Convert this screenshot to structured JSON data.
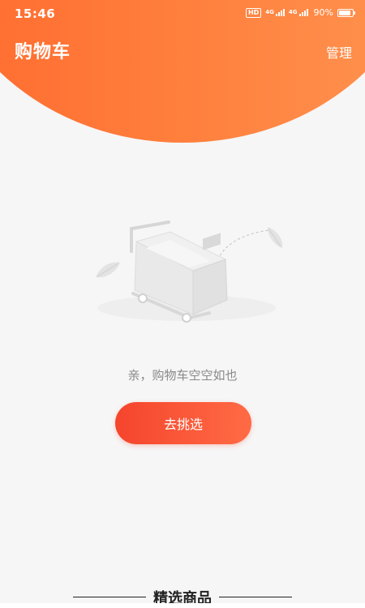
{
  "status_bar": {
    "time": "15:46",
    "hd_label": "HD",
    "network_1": "4G",
    "network_2": "4G",
    "battery_percent_text": "90%",
    "battery_level": 0.9
  },
  "header": {
    "title": "购物车",
    "manage_label": "管理",
    "gradient_colors": [
      "#ff6a2f",
      "#ff9450"
    ]
  },
  "empty_state": {
    "illustration_icon": "empty-cart-illustration",
    "message": "亲，购物车空空如也",
    "button_label": "去挑选",
    "button_colors": [
      "#f5452d",
      "#ff6b45"
    ]
  },
  "featured": {
    "title": "精选商品"
  },
  "bottom_nav": {
    "icons": [
      "home-icon",
      "category-icon",
      "cart-icon",
      "profile-icon"
    ]
  }
}
